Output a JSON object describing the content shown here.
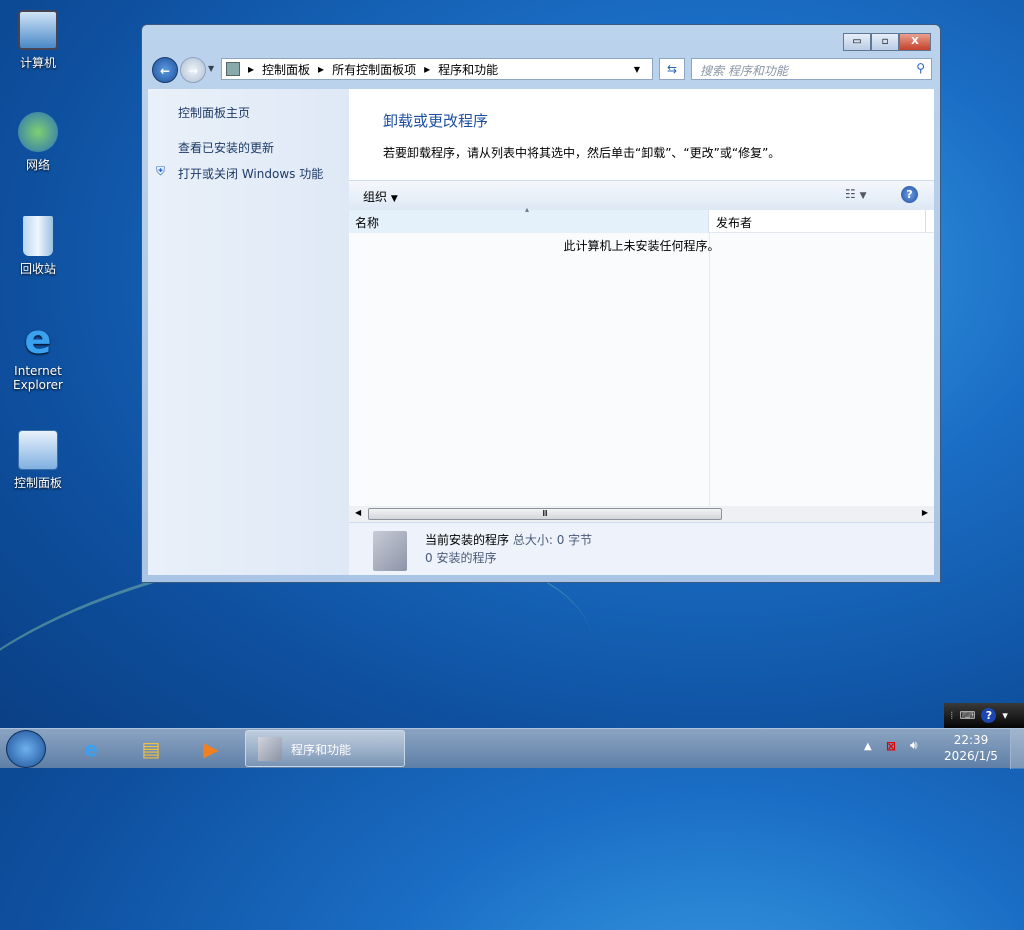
{
  "desktop": {
    "icons": [
      {
        "label": "计算机"
      },
      {
        "label": "网络"
      },
      {
        "label": "回收站"
      },
      {
        "label": "Internet Explorer"
      },
      {
        "label": "控制面板"
      }
    ]
  },
  "window": {
    "caption_buttons": {
      "minimize": "▭",
      "maximize": "▫",
      "close": "X"
    },
    "breadcrumb": [
      "控制面板",
      "所有控制面板项",
      "程序和功能"
    ],
    "search_placeholder": "搜索 程序和功能",
    "sidebar": {
      "items": [
        {
          "label": "控制面板主页"
        },
        {
          "label": "查看已安装的更新"
        },
        {
          "label": "打开或关闭 Windows 功能"
        }
      ]
    },
    "heading": "卸载或更改程序",
    "description": "若要卸载程序，请从列表中将其选中，然后单击“卸载”、“更改”或“修复”。",
    "toolbar": {
      "organize": "组织"
    },
    "columns": [
      "名称",
      "发布者"
    ],
    "empty_message": "此计算机上未安装任何程序。",
    "details": {
      "title": "当前安装的程序",
      "size_label": "总大小: 0 字节",
      "count": "0 安装的程序"
    }
  },
  "taskbar": {
    "active_window": "程序和功能",
    "time": "22:39",
    "date": "2026/1/5"
  }
}
